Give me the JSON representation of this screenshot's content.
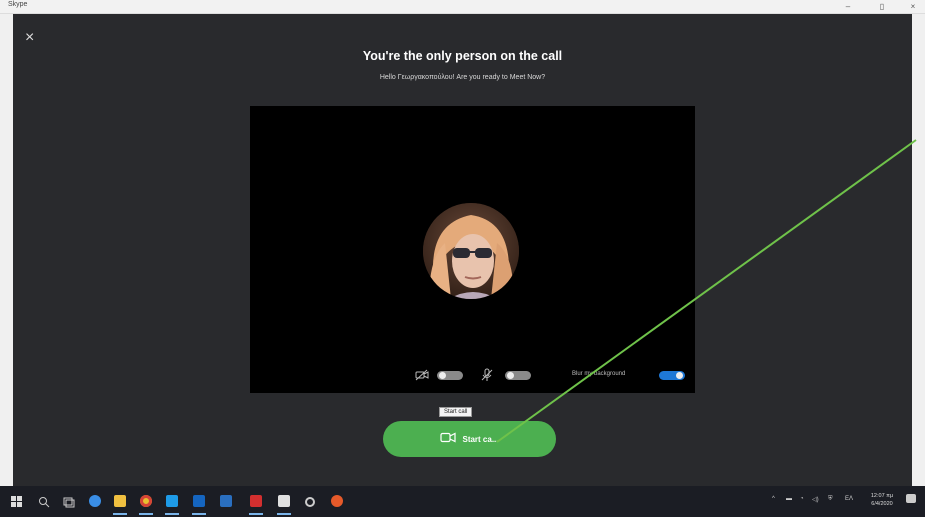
{
  "window": {
    "title": "Skype",
    "minimize": "–",
    "maximize": "▯",
    "close": "×"
  },
  "call": {
    "close_label": "×",
    "heading": "You're the only person on the call",
    "subheading": "Hello Γεωργακοπούλου! Are you ready to Meet Now?",
    "blur_label": "Blur my background",
    "camera_toggle_on": false,
    "mic_toggle_on": false,
    "blur_toggle_on": true,
    "tooltip": "Start call",
    "start_button_label": "Start ca...",
    "start_button_color": "#4caf50"
  },
  "annotation": {
    "color": "#6fc24a"
  },
  "taskbar": {
    "clock_time": "12:07 πμ",
    "clock_date": "6/4/2020",
    "icons": [
      "windows-icon",
      "search-icon",
      "task-view-icon",
      "edge-icon",
      "file-explorer-icon",
      "chrome-icon",
      "skype-icon",
      "outlook-icon",
      "acrobat-icon",
      "store-icon",
      "settings-icon",
      "recorder-icon"
    ]
  }
}
